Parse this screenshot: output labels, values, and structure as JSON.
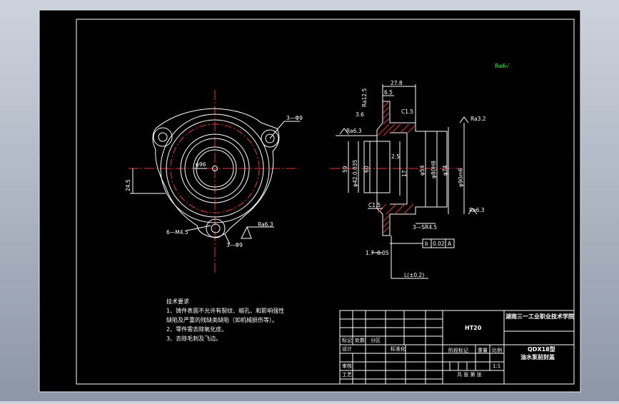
{
  "drawing": {
    "mark": "Ra6√",
    "front_view": {
      "dims": {
        "phi96": "φ96",
        "holes_3": "3—Φ9",
        "holes_6": "6—M4.5",
        "width_24_5": "24.5",
        "angle_3_phi": "3—Φ9",
        "ra_6_3": "Ra6.3"
      }
    },
    "section_view": {
      "dims": {
        "top_27_8": "27.8",
        "top_6_5": "6.5",
        "h_3_6": "3.6",
        "c1_5_top": "C1.5",
        "ra12_5": "Ra12.5",
        "ra6_3_left": "Ra6.3",
        "d_42": "φ42.0.035",
        "d_59": "59",
        "d_60": "60",
        "d_54": "φ54",
        "d_74": "φ74",
        "d_80": "φ80H8",
        "d_90": "φ90m6",
        "ra3_2": "Ra3.2",
        "h_17": "17",
        "h_2_5": "2.5",
        "c1_5_bot": "C1.5",
        "sr4_5": "3—SR4.5",
        "bottom_1_7": "1.7",
        "bottom_0_05": "0.05",
        "tol_b": "b",
        "tol_val": "0.02",
        "tol_a": "A",
        "bottom_tol": "L(±0.2)",
        "left_ra": "Ra6.3"
      }
    }
  },
  "tech_requirements": {
    "title": "技术要求",
    "lines": [
      "1、铸件表面不允许有裂纹、缩孔、和影响强性",
      "    缺陷及严重的残缺类缺陷（如机械损伤等）。",
      "2、零件需去除氧化皮。",
      "3、去除毛刺及飞边。"
    ]
  },
  "title_block": {
    "material": "HT20",
    "school": "湖南三一工业职业技术学院",
    "part_code": "QDX18型",
    "part_name": "油水泵前封盖",
    "labels": {
      "mark": "标记",
      "zone": "处数",
      "split": "分区",
      "design": "设计",
      "standard": "标准化",
      "stage_mark": "阶段标记",
      "weight": "重量",
      "scale": "比例",
      "scale_val": "1:1",
      "review": "审核",
      "process": "工艺",
      "sheets": "共 张 第 张"
    }
  }
}
